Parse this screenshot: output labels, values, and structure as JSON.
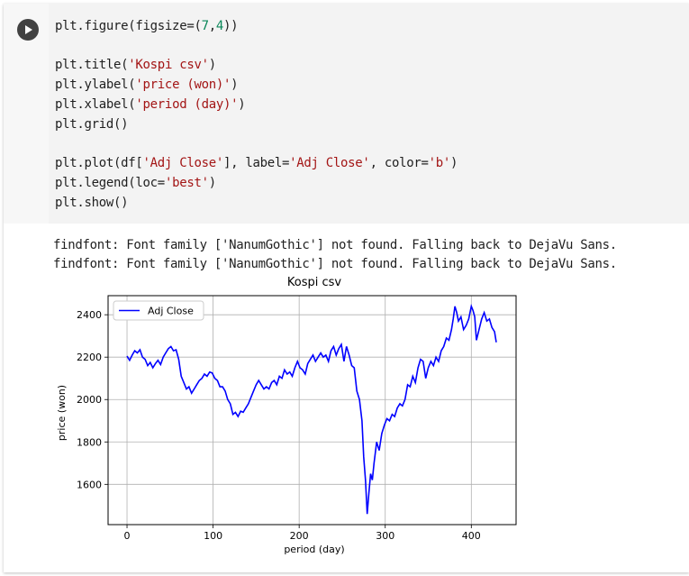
{
  "code_lines": [
    "plt.figure(figsize=(7,4))",
    "",
    "plt.title('Kospi csv')",
    "plt.ylabel('price (won)')",
    "plt.xlabel('period (day)')",
    "plt.grid()",
    "",
    "plt.plot(df['Adj Close'], label='Adj Close', color='b')",
    "plt.legend(loc='best')",
    "plt.show()"
  ],
  "output_lines": [
    "findfont: Font family ['NanumGothic'] not found. Falling back to DejaVu Sans.",
    "findfont: Font family ['NanumGothic'] not found. Falling back to DejaVu Sans."
  ],
  "chart_data": {
    "type": "line",
    "title": "Kospi csv",
    "xlabel": "period (day)",
    "ylabel": "price (won)",
    "xlim": [
      -22,
      452
    ],
    "ylim": [
      1410,
      2490
    ],
    "xticks": [
      0,
      100,
      200,
      300,
      400
    ],
    "yticks": [
      1600,
      1800,
      2000,
      2200,
      2400
    ],
    "grid": true,
    "legend_placement": "upper-left",
    "series": [
      {
        "name": "Adj Close",
        "color": "#0000ff",
        "points": [
          [
            0,
            2205
          ],
          [
            3,
            2185
          ],
          [
            6,
            2210
          ],
          [
            9,
            2230
          ],
          [
            12,
            2220
          ],
          [
            15,
            2235
          ],
          [
            18,
            2200
          ],
          [
            21,
            2190
          ],
          [
            24,
            2160
          ],
          [
            27,
            2175
          ],
          [
            30,
            2150
          ],
          [
            33,
            2170
          ],
          [
            36,
            2185
          ],
          [
            39,
            2165
          ],
          [
            42,
            2200
          ],
          [
            45,
            2220
          ],
          [
            48,
            2240
          ],
          [
            51,
            2250
          ],
          [
            54,
            2230
          ],
          [
            57,
            2235
          ],
          [
            60,
            2190
          ],
          [
            63,
            2110
          ],
          [
            66,
            2080
          ],
          [
            69,
            2050
          ],
          [
            72,
            2060
          ],
          [
            75,
            2030
          ],
          [
            78,
            2050
          ],
          [
            81,
            2070
          ],
          [
            84,
            2090
          ],
          [
            87,
            2100
          ],
          [
            90,
            2120
          ],
          [
            93,
            2110
          ],
          [
            96,
            2130
          ],
          [
            99,
            2125
          ],
          [
            102,
            2100
          ],
          [
            105,
            2090
          ],
          [
            108,
            2060
          ],
          [
            111,
            2060
          ],
          [
            114,
            2040
          ],
          [
            117,
            2000
          ],
          [
            120,
            1980
          ],
          [
            123,
            1930
          ],
          [
            126,
            1940
          ],
          [
            129,
            1920
          ],
          [
            132,
            1945
          ],
          [
            135,
            1940
          ],
          [
            138,
            1960
          ],
          [
            141,
            1980
          ],
          [
            144,
            2010
          ],
          [
            147,
            2040
          ],
          [
            150,
            2070
          ],
          [
            153,
            2090
          ],
          [
            156,
            2070
          ],
          [
            159,
            2050
          ],
          [
            162,
            2060
          ],
          [
            165,
            2050
          ],
          [
            168,
            2080
          ],
          [
            171,
            2090
          ],
          [
            174,
            2070
          ],
          [
            177,
            2110
          ],
          [
            180,
            2100
          ],
          [
            183,
            2140
          ],
          [
            186,
            2120
          ],
          [
            189,
            2130
          ],
          [
            192,
            2110
          ],
          [
            195,
            2150
          ],
          [
            198,
            2180
          ],
          [
            201,
            2150
          ],
          [
            204,
            2140
          ],
          [
            207,
            2120
          ],
          [
            210,
            2170
          ],
          [
            213,
            2190
          ],
          [
            216,
            2210
          ],
          [
            219,
            2180
          ],
          [
            222,
            2200
          ],
          [
            225,
            2220
          ],
          [
            228,
            2200
          ],
          [
            231,
            2210
          ],
          [
            234,
            2180
          ],
          [
            237,
            2230
          ],
          [
            240,
            2250
          ],
          [
            243,
            2210
          ],
          [
            246,
            2240
          ],
          [
            249,
            2260
          ],
          [
            252,
            2180
          ],
          [
            255,
            2250
          ],
          [
            258,
            2210
          ],
          [
            261,
            2160
          ],
          [
            264,
            2150
          ],
          [
            267,
            2040
          ],
          [
            270,
            2000
          ],
          [
            273,
            1900
          ],
          [
            275,
            1730
          ],
          [
            277,
            1620
          ],
          [
            279,
            1460
          ],
          [
            281,
            1560
          ],
          [
            283,
            1650
          ],
          [
            285,
            1620
          ],
          [
            287,
            1700
          ],
          [
            290,
            1800
          ],
          [
            293,
            1760
          ],
          [
            296,
            1840
          ],
          [
            299,
            1880
          ],
          [
            302,
            1910
          ],
          [
            305,
            1900
          ],
          [
            308,
            1930
          ],
          [
            311,
            1920
          ],
          [
            314,
            1960
          ],
          [
            317,
            1980
          ],
          [
            320,
            1970
          ],
          [
            323,
            2000
          ],
          [
            326,
            2070
          ],
          [
            329,
            2060
          ],
          [
            332,
            2110
          ],
          [
            335,
            2080
          ],
          [
            338,
            2150
          ],
          [
            341,
            2190
          ],
          [
            344,
            2180
          ],
          [
            347,
            2100
          ],
          [
            350,
            2150
          ],
          [
            353,
            2180
          ],
          [
            356,
            2160
          ],
          [
            359,
            2200
          ],
          [
            362,
            2180
          ],
          [
            365,
            2230
          ],
          [
            368,
            2250
          ],
          [
            371,
            2290
          ],
          [
            374,
            2280
          ],
          [
            377,
            2330
          ],
          [
            379,
            2380
          ],
          [
            381,
            2440
          ],
          [
            383,
            2410
          ],
          [
            385,
            2370
          ],
          [
            388,
            2390
          ],
          [
            391,
            2330
          ],
          [
            394,
            2350
          ],
          [
            397,
            2380
          ],
          [
            400,
            2440
          ],
          [
            402,
            2420
          ],
          [
            404,
            2390
          ],
          [
            406,
            2280
          ],
          [
            409,
            2330
          ],
          [
            412,
            2380
          ],
          [
            415,
            2410
          ],
          [
            418,
            2370
          ],
          [
            421,
            2380
          ],
          [
            424,
            2340
          ],
          [
            427,
            2320
          ],
          [
            429,
            2270
          ]
        ]
      }
    ]
  }
}
